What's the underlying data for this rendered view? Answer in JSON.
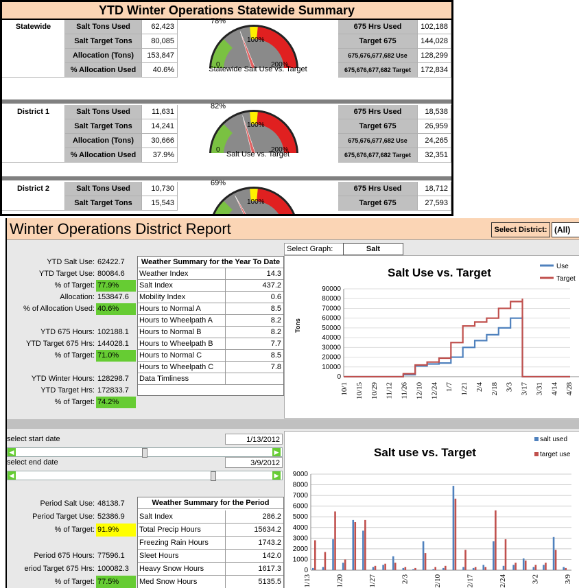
{
  "summary": {
    "title": "YTD Winter Operations Statewide Summary",
    "blocks": [
      {
        "name": "Statewide",
        "rows": [
          {
            "label": "Salt Tons Used",
            "value": "62,423",
            "right_label": "675 Hrs Used",
            "right_value": "102,188"
          },
          {
            "label": "Salt Target Tons",
            "value": "80,085",
            "right_label": "Target 675",
            "right_value": "144,028"
          },
          {
            "label": "Allocation (Tons)",
            "value": "153,847",
            "right_label": "675,676,677,682 Use",
            "right_value": "128,299"
          },
          {
            "label": "% Allocation Used",
            "value": "40.6%",
            "right_label": "675,676,677,682 Target",
            "right_value": "172,834"
          }
        ],
        "gauge": {
          "pct_label": "78%",
          "pct": 0.78,
          "mark_100": "100%",
          "mark_0": "0",
          "mark_200": "200%",
          "caption": "Statewide Salt Use vs. Target"
        }
      },
      {
        "name": "District 1",
        "rows": [
          {
            "label": "Salt Tons Used",
            "value": "11,631",
            "right_label": "675 Hrs Used",
            "right_value": "18,538"
          },
          {
            "label": "Salt Target Tons",
            "value": "14,241",
            "right_label": "Target 675",
            "right_value": "26,959"
          },
          {
            "label": "Allocation (Tons)",
            "value": "30,666",
            "right_label": "675,676,677,682 Use",
            "right_value": "24,265"
          },
          {
            "label": "% Allocation Used",
            "value": "37.9%",
            "right_label": "675,676,677,682 Target",
            "right_value": "32,351"
          }
        ],
        "gauge": {
          "pct_label": "82%",
          "pct": 0.82,
          "mark_100": "100%",
          "mark_0": "0",
          "mark_200": "200%",
          "caption": "Salt Use vs. Target"
        }
      },
      {
        "name": "District 2",
        "rows": [
          {
            "label": "Salt Tons Used",
            "value": "10,730",
            "right_label": "675 Hrs Used",
            "right_value": "18,712"
          },
          {
            "label": "Salt Target Tons",
            "value": "15,543",
            "right_label": "Target 675",
            "right_value": "27,593"
          }
        ],
        "gauge": {
          "pct_label": "69%",
          "pct": 0.69,
          "mark_100": "100%",
          "mark_0": "",
          "mark_200": "",
          "caption": ""
        }
      }
    ]
  },
  "report": {
    "title": "Winter Operations District Report",
    "select_district_label": "Select District:",
    "select_district_value": "(All)",
    "select_graph_label": "Select Graph:",
    "select_graph_value": "Salt",
    "ytd": [
      {
        "label": "YTD Salt Use:",
        "value": "62422.7",
        "hl": ""
      },
      {
        "label": "YTD Target Use:",
        "value": "80084.6",
        "hl": ""
      },
      {
        "label": "% of Target:",
        "value": "77.9%",
        "hl": "green"
      },
      {
        "label": "Allocation:",
        "value": "153847.6",
        "hl": ""
      },
      {
        "label": "% of Allocation Used:",
        "value": "40.6%",
        "hl": "green"
      },
      {
        "label": "",
        "value": "",
        "hl": ""
      },
      {
        "label": "YTD 675 Hours:",
        "value": "102188.1",
        "hl": ""
      },
      {
        "label": "YTD Target 675 Hrs:",
        "value": "144028.1",
        "hl": ""
      },
      {
        "label": "% of Target:",
        "value": "71.0%",
        "hl": "green"
      },
      {
        "label": "",
        "value": "",
        "hl": ""
      },
      {
        "label": "YTD Winter Hours:",
        "value": "128298.7",
        "hl": ""
      },
      {
        "label": "YTD Target  Hrs:",
        "value": "172833.7",
        "hl": ""
      },
      {
        "label": "% of Target:",
        "value": "74.2%",
        "hl": "green"
      }
    ],
    "weather_ytd": {
      "title": "Weather Summary for the Year To Date",
      "rows": [
        {
          "label": "Weather Index",
          "value": "14.3"
        },
        {
          "label": "Salt Index",
          "value": "437.2"
        },
        {
          "label": "Mobility Index",
          "value": "0.6"
        },
        {
          "label": "Hours to Normal A",
          "value": "8.5"
        },
        {
          "label": "Hours to Wheelpath A",
          "value": "8.2"
        },
        {
          "label": "Hours to Normal B",
          "value": "8.2"
        },
        {
          "label": "Hours to Wheelpath B",
          "value": "7.7"
        },
        {
          "label": "Hours to Normal C",
          "value": "8.5"
        },
        {
          "label": "Hours to Wheelpath C",
          "value": "7.8"
        },
        {
          "label": "Data Timliness",
          "value": ""
        }
      ]
    },
    "start_date_label": "select start date",
    "start_date_value": "1/13/2012",
    "end_date_label": "select end date",
    "end_date_value": "3/9/2012",
    "period": [
      {
        "label": "Period Salt Use:",
        "value": "48138.7",
        "hl": ""
      },
      {
        "label": "Period Target Use:",
        "value": "52386.9",
        "hl": ""
      },
      {
        "label": "% of Target:",
        "value": "91.9%",
        "hl": "yellow"
      },
      {
        "label": "",
        "value": "",
        "hl": ""
      },
      {
        "label": "Period 675 Hours:",
        "value": "77596.1",
        "hl": ""
      },
      {
        "label": "eriod Target 675 Hrs:",
        "value": "100082.3",
        "hl": ""
      },
      {
        "label": "% of Target:",
        "value": "77.5%",
        "hl": "green"
      }
    ],
    "weather_period": {
      "title": "Weather Summary for the Period",
      "rows": [
        {
          "label": "Salt Index",
          "value": "286.2"
        },
        {
          "label": "Total Precip Hours",
          "value": "15634.2"
        },
        {
          "label": "Freezing Rain Hours",
          "value": "1743.2"
        },
        {
          "label": "Sleet Hours",
          "value": "142.0"
        },
        {
          "label": "Heavy Snow Hours",
          "value": "1617.3"
        },
        {
          "label": "Med Snow Hours",
          "value": "5135.5"
        }
      ]
    }
  },
  "chart_data": [
    {
      "type": "line",
      "title": "Salt Use vs. Target",
      "ylabel": "Tons",
      "ylim": [
        0,
        90000
      ],
      "yticks": [
        "0",
        "10000",
        "20000",
        "30000",
        "40000",
        "50000",
        "60000",
        "70000",
        "80000",
        "90000"
      ],
      "xticks": [
        "10/1",
        "10/15",
        "10/29",
        "11/12",
        "11/26",
        "12/10",
        "12/24",
        "1/7",
        "1/21",
        "2/4",
        "2/18",
        "3/3",
        "3/17",
        "3/31",
        "4/14",
        "4/28"
      ],
      "legend_position": "top-right",
      "series": [
        {
          "name": "Use",
          "color": "#4f81bd",
          "values": [
            0,
            0,
            0,
            0,
            0,
            2000,
            11000,
            13000,
            14000,
            20000,
            30000,
            37000,
            43000,
            50000,
            60000,
            62400,
            0,
            0,
            0,
            0
          ]
        },
        {
          "name": "Target",
          "color": "#c0504d",
          "values": [
            0,
            0,
            0,
            0,
            0,
            3000,
            12000,
            15000,
            19000,
            35000,
            52000,
            56000,
            60000,
            70000,
            77000,
            80000,
            0,
            0,
            0,
            0
          ]
        }
      ]
    },
    {
      "type": "bar",
      "title": "Salt use vs. Target",
      "ylim": [
        0,
        9000
      ],
      "yticks": [
        "0",
        "1000",
        "2000",
        "3000",
        "4000",
        "5000",
        "6000",
        "7000",
        "8000",
        "9000"
      ],
      "xticks": [
        "1/13",
        "1/20",
        "1/27",
        "2/3",
        "2/10",
        "2/17",
        "2/24",
        "3/2",
        "3/9"
      ],
      "legend_position": "top-right",
      "series": [
        {
          "name": "salt used",
          "color": "#4f81bd",
          "values": [
            200,
            300,
            2900,
            700,
            4700,
            3700,
            300,
            500,
            1300,
            200,
            100,
            2700,
            100,
            200,
            7900,
            300,
            200,
            500,
            2700,
            400,
            500,
            1100,
            300,
            500,
            3100,
            300
          ]
        },
        {
          "name": "target use",
          "color": "#c0504d",
          "values": [
            2800,
            1700,
            5500,
            1000,
            4500,
            4700,
            400,
            600,
            700,
            300,
            200,
            1600,
            300,
            400,
            6700,
            1900,
            300,
            300,
            5600,
            2900,
            700,
            900,
            500,
            700,
            1900,
            200
          ]
        }
      ]
    }
  ]
}
